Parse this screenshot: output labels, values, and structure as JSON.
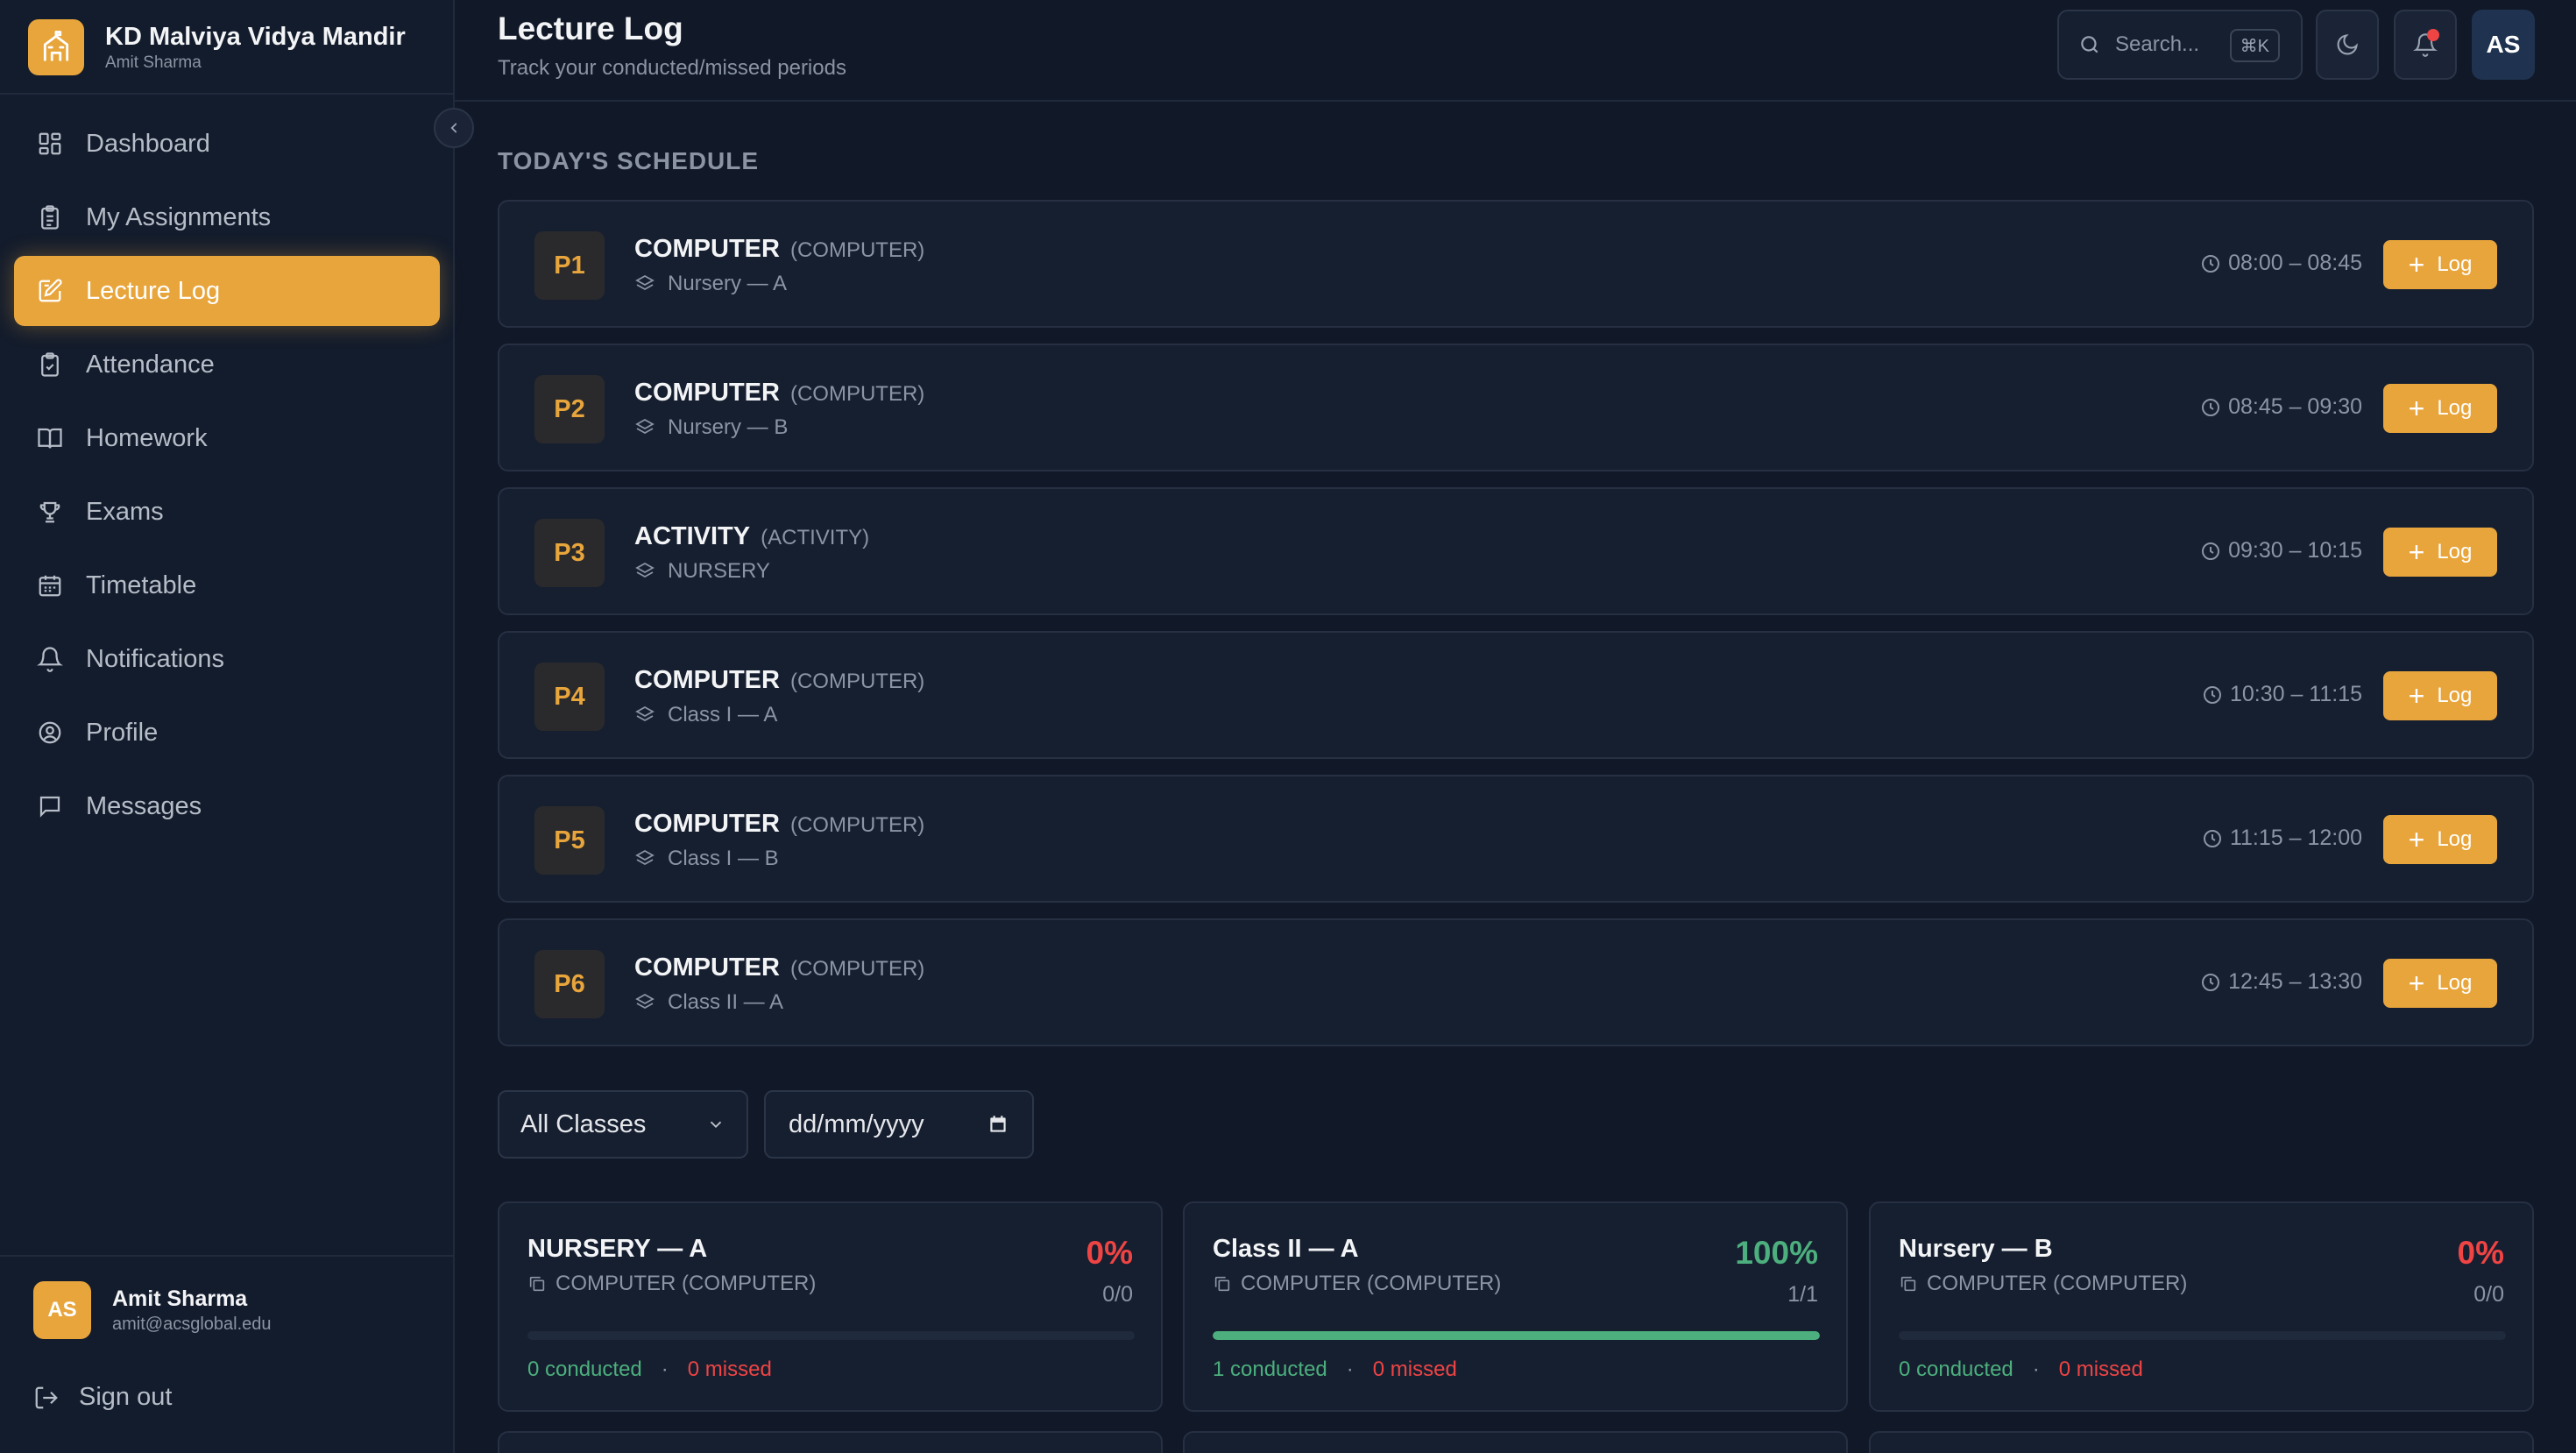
{
  "brand": {
    "name": "KD Malviya Vidya Mandir",
    "user": "Amit Sharma"
  },
  "nav": [
    {
      "label": "Dashboard",
      "icon": "dashboard-icon"
    },
    {
      "label": "My Assignments",
      "icon": "clipboard-icon"
    },
    {
      "label": "Lecture Log",
      "icon": "edit-note-icon",
      "active": true
    },
    {
      "label": "Attendance",
      "icon": "clipboard-check-icon"
    },
    {
      "label": "Homework",
      "icon": "book-open-icon"
    },
    {
      "label": "Exams",
      "icon": "trophy-icon"
    },
    {
      "label": "Timetable",
      "icon": "calendar-icon"
    },
    {
      "label": "Notifications",
      "icon": "bell-icon"
    },
    {
      "label": "Profile",
      "icon": "user-circle-icon"
    },
    {
      "label": "Messages",
      "icon": "message-icon"
    }
  ],
  "sidebar_user": {
    "initials": "AS",
    "name": "Amit Sharma",
    "email": "amit@acsglobal.edu"
  },
  "signout_label": "Sign out",
  "header": {
    "title": "Lecture Log",
    "subtitle": "Track your conducted/missed periods",
    "search_placeholder": "Search...",
    "search_shortcut": "⌘K",
    "avatar_initials": "AS"
  },
  "schedule_title": "TODAY'S SCHEDULE",
  "schedule": [
    {
      "period": "P1",
      "subject": "COMPUTER",
      "code": "(COMPUTER)",
      "class": "Nursery — A",
      "time": "08:00 – 08:45",
      "action": "Log"
    },
    {
      "period": "P2",
      "subject": "COMPUTER",
      "code": "(COMPUTER)",
      "class": "Nursery — B",
      "time": "08:45 – 09:30",
      "action": "Log"
    },
    {
      "period": "P3",
      "subject": "ACTIVITY",
      "code": "(ACTIVITY)",
      "class": "NURSERY",
      "time": "09:30 – 10:15",
      "action": "Log"
    },
    {
      "period": "P4",
      "subject": "COMPUTER",
      "code": "(COMPUTER)",
      "class": "Class I — A",
      "time": "10:30 – 11:15",
      "action": "Log"
    },
    {
      "period": "P5",
      "subject": "COMPUTER",
      "code": "(COMPUTER)",
      "class": "Class I — B",
      "time": "11:15 – 12:00",
      "action": "Log"
    },
    {
      "period": "P6",
      "subject": "COMPUTER",
      "code": "(COMPUTER)",
      "class": "Class II — A",
      "time": "12:45 – 13:30",
      "action": "Log"
    }
  ],
  "filters": {
    "class_select": "All Classes",
    "date_placeholder": "dd/mm/yyyy"
  },
  "cards": [
    {
      "title": "NURSERY — A",
      "subject": "COMPUTER (COMPUTER)",
      "percent": "0%",
      "fraction": "0/0",
      "progress": 0,
      "conducted": "0 conducted",
      "missed": "0 missed",
      "pct_color": "#ef4444"
    },
    {
      "title": "Class II — A",
      "subject": "COMPUTER (COMPUTER)",
      "percent": "100%",
      "fraction": "1/1",
      "progress": 1,
      "conducted": "1 conducted",
      "missed": "0 missed",
      "pct_color": "#4caf7d"
    },
    {
      "title": "Nursery — B",
      "subject": "COMPUTER (COMPUTER)",
      "percent": "0%",
      "fraction": "0/0",
      "progress": 0,
      "conducted": "0 conducted",
      "missed": "0 missed",
      "pct_color": "#ef4444"
    }
  ],
  "colors": {
    "accent": "#e8a53c",
    "success": "#4caf7d",
    "danger": "#ef4444",
    "background": "#111827"
  }
}
